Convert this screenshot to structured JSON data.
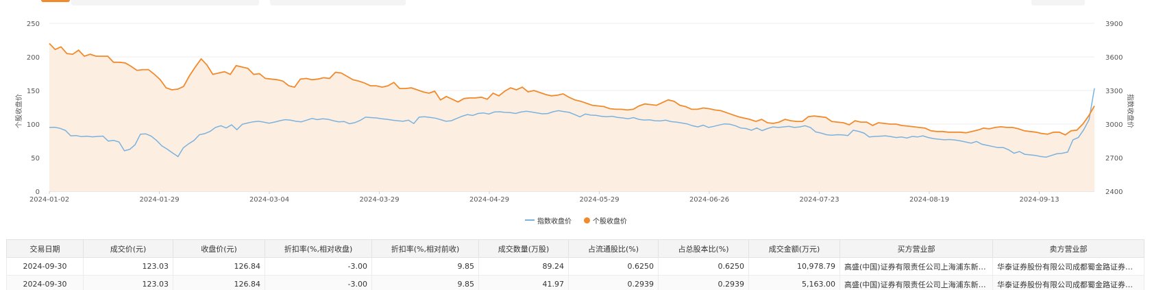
{
  "chart_data": {
    "type": "line",
    "x_ticks": [
      "2024-01-02",
      "2024-01-29",
      "2024-03-04",
      "2024-03-29",
      "2024-04-29",
      "2024-05-29",
      "2024-06-26",
      "2024-07-23",
      "2024-08-19",
      "2024-09-13"
    ],
    "ylabel_left": "个股收盘价",
    "ylabel_right": "指数收盘价",
    "ylim_left": [
      0,
      250
    ],
    "ylim_right": [
      2400,
      3900
    ],
    "yticks_left": [
      0,
      50,
      100,
      150,
      200,
      250
    ],
    "yticks_right": [
      2400,
      2700,
      3000,
      3300,
      3600,
      3900
    ],
    "grid": true,
    "legend_position": "bottom-center",
    "series": [
      {
        "name": "指数收盘价",
        "axis": "right",
        "color": "#7ab2de",
        "values": [
          2970,
          2972,
          2962,
          2943,
          2895,
          2898,
          2888,
          2892,
          2886,
          2890,
          2893,
          2848,
          2854,
          2840,
          2762,
          2774,
          2816,
          2910,
          2913,
          2893,
          2854,
          2805,
          2776,
          2742,
          2710,
          2788,
          2824,
          2854,
          2905,
          2915,
          2935,
          2970,
          2985,
          2965,
          2993,
          2950,
          2998,
          3010,
          3020,
          3025,
          3018,
          3008,
          3018,
          3030,
          3040,
          3035,
          3025,
          3020,
          3035,
          3050,
          3040,
          3048,
          3043,
          3030,
          3020,
          3023,
          3003,
          3013,
          3033,
          3062,
          3058,
          3055,
          3048,
          3043,
          3035,
          3030,
          3025,
          3035,
          3005,
          3062,
          3066,
          3060,
          3053,
          3040,
          3025,
          3030,
          3050,
          3070,
          3085,
          3077,
          3095,
          3100,
          3090,
          3108,
          3110,
          3105,
          3102,
          3095,
          3108,
          3115,
          3108,
          3100,
          3092,
          3094,
          3110,
          3120,
          3112,
          3105,
          3085,
          3065,
          3090,
          3080,
          3078,
          3070,
          3066,
          3070,
          3060,
          3055,
          3048,
          3058,
          3042,
          3036,
          3038,
          3030,
          3028,
          3035,
          3022,
          3018,
          3010,
          3002,
          2985,
          2975,
          2990,
          2970,
          2980,
          2992,
          3002,
          2998,
          2985,
          2965,
          2960,
          2945,
          2965,
          2942,
          2960,
          2975,
          2970,
          2975,
          2980,
          2970,
          2975,
          2985,
          2970,
          2930,
          2920,
          2905,
          2900,
          2905,
          2904,
          2898,
          2945,
          2935,
          2920,
          2885,
          2890,
          2892,
          2895,
          2888,
          2880,
          2885,
          2875,
          2890,
          2885,
          2895,
          2880,
          2870,
          2865,
          2860,
          2862,
          2858,
          2850,
          2840,
          2830,
          2845,
          2820,
          2810,
          2800,
          2790,
          2790,
          2770,
          2740,
          2755,
          2730,
          2725,
          2720,
          2710,
          2705,
          2720,
          2735,
          2740,
          2750,
          2860,
          2880,
          2950,
          3040,
          3320
        ]
      },
      {
        "name": "个股收盘价",
        "axis": "left",
        "color": "#f08a2c",
        "values": [
          220,
          211,
          215,
          205,
          204,
          210,
          201,
          204,
          201,
          201,
          201,
          192,
          192,
          191,
          186,
          180,
          181,
          181,
          174,
          166,
          154,
          151,
          152,
          156,
          172,
          185,
          197,
          188,
          174,
          176,
          178,
          174,
          187,
          185,
          183,
          174,
          175,
          168,
          167,
          166,
          164,
          157,
          155,
          167,
          168,
          166,
          167,
          169,
          168,
          177,
          176,
          171,
          166,
          164,
          161,
          157,
          157,
          155,
          157,
          162,
          153,
          153,
          154,
          151,
          148,
          146,
          149,
          136,
          141,
          137,
          133,
          138,
          139,
          139,
          140,
          137,
          146,
          142,
          149,
          154,
          151,
          155,
          148,
          150,
          147,
          144,
          142,
          143,
          145,
          140,
          136,
          134,
          131,
          128,
          127,
          126,
          123,
          122,
          122,
          121,
          122,
          127,
          130,
          129,
          128,
          132,
          136,
          134,
          128,
          126,
          122,
          122,
          124,
          123,
          121,
          120,
          117,
          114,
          111,
          109,
          107,
          104,
          107,
          102,
          101,
          103,
          107,
          105,
          104,
          104,
          111,
          112,
          111,
          110,
          104,
          103,
          102,
          99,
          105,
          103,
          103,
          98,
          102,
          101,
          100,
          100,
          98,
          97,
          96,
          95,
          94,
          90,
          89,
          89,
          88,
          88,
          88,
          87,
          89,
          91,
          94,
          93,
          95,
          96,
          95,
          95,
          93,
          90,
          89,
          88,
          86,
          85,
          88,
          88,
          84,
          90,
          91,
          100,
          112,
          127
        ]
      }
    ]
  },
  "legend": {
    "index_label": "指数收盘价",
    "stock_label": "个股收盘价"
  },
  "table": {
    "headers": [
      "交易日期",
      "成交价(元)",
      "收盘价(元)",
      "折扣率(%,相对收盘)",
      "折扣率(%,相对前收)",
      "成交数量(万股)",
      "占流通股比(%)",
      "占总股本比(%)",
      "成交金额(万元)",
      "买方营业部",
      "卖方营业部"
    ],
    "rows": [
      [
        "2024-09-30",
        "123.03",
        "126.84",
        "-3.00",
        "9.85",
        "89.24",
        "0.6250",
        "0.6250",
        "10,978.79",
        "高盛(中国)证券有限责任公司上海浦东新区世纪大道证券营业部",
        "华泰证券股份有限公司成都蜀金路证券营业部"
      ],
      [
        "2024-09-30",
        "123.03",
        "126.84",
        "-3.00",
        "9.85",
        "41.97",
        "0.2939",
        "0.2939",
        "5,163.00",
        "高盛(中国)证券有限责任公司上海浦东新区世纪大道证券营业部",
        "华泰证券股份有限公司成都蜀金路证券营业部"
      ]
    ]
  }
}
